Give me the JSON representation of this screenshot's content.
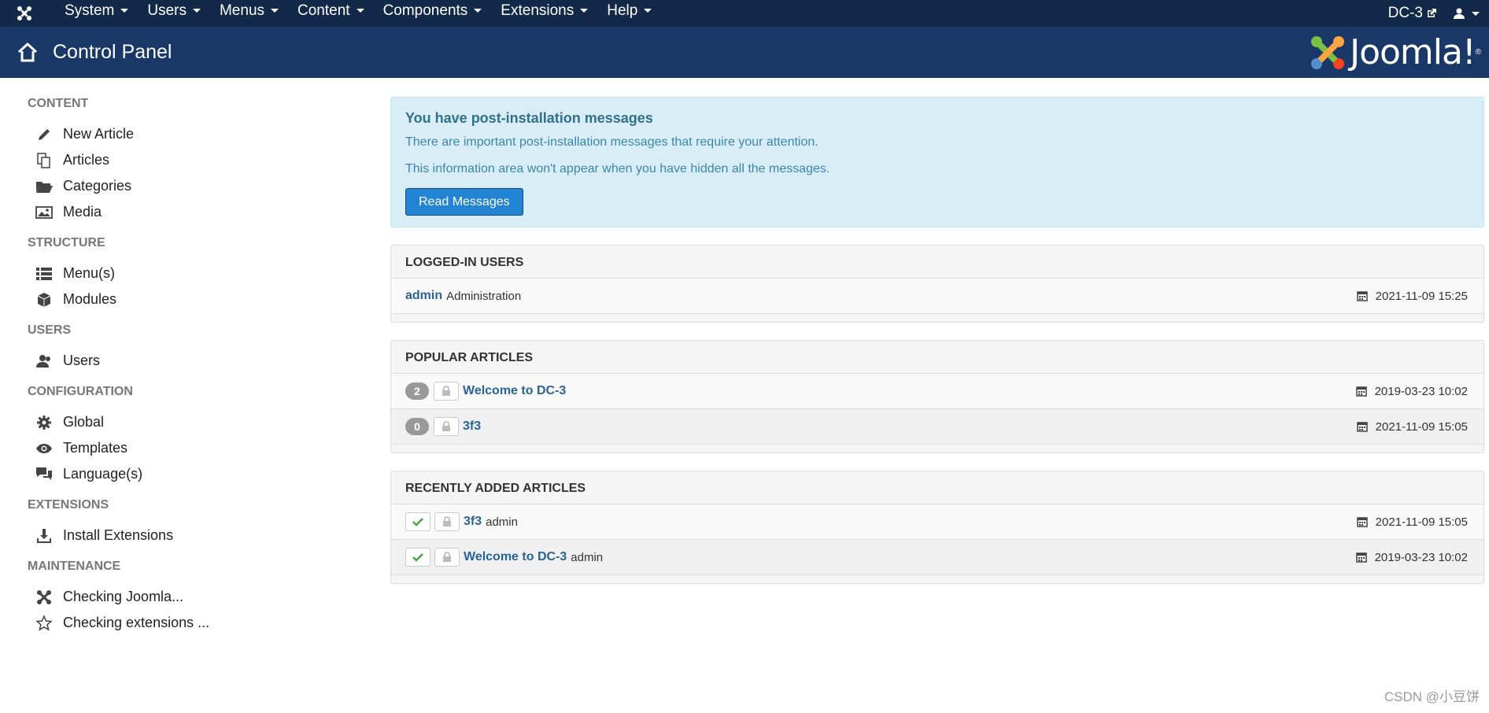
{
  "topnav": {
    "menu": [
      "System",
      "Users",
      "Menus",
      "Content",
      "Components",
      "Extensions",
      "Help"
    ],
    "site_link": "DC-3"
  },
  "header": {
    "title": "Control Panel",
    "brand": "Joomla!",
    "brand_reg": "®"
  },
  "sidebar": {
    "sections": [
      {
        "title": "CONTENT",
        "items": [
          {
            "label": "New Article",
            "icon": "pencil-icon"
          },
          {
            "label": "Articles",
            "icon": "copy-icon"
          },
          {
            "label": "Categories",
            "icon": "folder-open-icon"
          },
          {
            "label": "Media",
            "icon": "image-icon"
          }
        ]
      },
      {
        "title": "STRUCTURE",
        "items": [
          {
            "label": "Menu(s)",
            "icon": "list-icon"
          },
          {
            "label": "Modules",
            "icon": "cube-icon"
          }
        ]
      },
      {
        "title": "USERS",
        "items": [
          {
            "label": "Users",
            "icon": "users-icon"
          }
        ]
      },
      {
        "title": "CONFIGURATION",
        "items": [
          {
            "label": "Global",
            "icon": "gear-icon"
          },
          {
            "label": "Templates",
            "icon": "eye-icon"
          },
          {
            "label": "Language(s)",
            "icon": "comments-icon"
          }
        ]
      },
      {
        "title": "EXTENSIONS",
        "items": [
          {
            "label": "Install Extensions",
            "icon": "download-icon"
          }
        ]
      },
      {
        "title": "MAINTENANCE",
        "items": [
          {
            "label": "Checking Joomla...",
            "icon": "joomla-icon"
          },
          {
            "label": "Checking extensions ...",
            "icon": "star-icon"
          }
        ]
      }
    ]
  },
  "alert": {
    "heading": "You have post-installation messages",
    "line1": "There are important post-installation messages that require your attention.",
    "line2": "This information area won't appear when you have hidden all the messages.",
    "button": "Read Messages"
  },
  "logged_in": {
    "title": "LOGGED-IN USERS",
    "rows": [
      {
        "user": "admin",
        "area": "Administration",
        "date": "2021-11-09 15:25"
      }
    ]
  },
  "popular": {
    "title": "POPULAR ARTICLES",
    "rows": [
      {
        "hits": "2",
        "title": "Welcome to DC-3",
        "date": "2019-03-23 10:02"
      },
      {
        "hits": "0",
        "title": "3f3",
        "date": "2021-11-09 15:05"
      }
    ]
  },
  "recent": {
    "title": "RECENTLY ADDED ARTICLES",
    "rows": [
      {
        "title": "3f3",
        "author": "admin",
        "date": "2021-11-09 15:05"
      },
      {
        "title": "Welcome to DC-3",
        "author": "admin",
        "date": "2019-03-23 10:02"
      }
    ]
  },
  "watermark": "CSDN @小豆饼",
  "colors": {
    "topnav": "#13294a",
    "header": "#1a3867",
    "link": "#2a6496",
    "alert_bg": "#d9edf7",
    "button": "#2384d3"
  }
}
